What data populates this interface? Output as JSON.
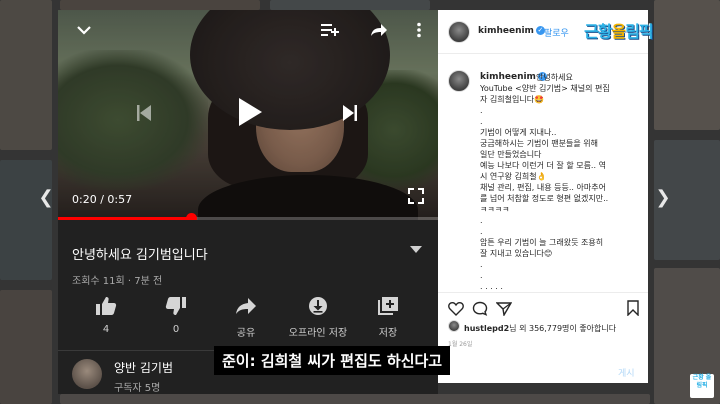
{
  "youtube": {
    "time_current": "0:20",
    "time_total": "0:57",
    "time_separator": " / ",
    "progress_fraction": 0.35,
    "video_title": "안녕하세요 김기범입니다",
    "video_meta": "조회수 11회 · 7분 전",
    "actions": [
      {
        "icon": "thumbs-up-icon",
        "label": "4"
      },
      {
        "icon": "thumbs-down-icon",
        "label": "0"
      },
      {
        "icon": "share-icon",
        "label": "공유"
      },
      {
        "icon": "download-icon",
        "label": "오프라인 저장"
      },
      {
        "icon": "save-to-playlist-icon",
        "label": "저장"
      }
    ],
    "channel_name": "양반 김기범",
    "channel_subscribers": "구독자 5명"
  },
  "instagram": {
    "username": "kimheenim",
    "follow_label": "팔로우",
    "caption_lines": [
      "안녕하세요",
      "YouTube <양반 김기범> 채널의 편집",
      "자 김희철입니다🤩",
      ".",
      ".",
      "기범이 어떻게 지내나..",
      "궁금해하시는 기범이 팬분들을 위해",
      "일단 만들었습니다",
      "예능 나보다 이런거 더 잘 할 모름.. 역",
      "시 연구왕 김희철👌",
      "채널 관리, 편집, 내용 등등.. 아마추어",
      "를 넘어 처참할 정도로 형편 없겠지만..",
      "ㅋㅋㅋㅋ",
      ".",
      ".",
      "암튼 우리 기범이 늘 그래왔듯 조용히",
      "잘 지내고 있습니다😊",
      ".",
      ".",
      ". . . . ."
    ],
    "likes_user": "hustlepd2",
    "likes_text": "님 외 356,779명이 좋아합니다",
    "date": "1월 26일",
    "post_label": "게시"
  },
  "overlay": {
    "logo_text_1": "근황",
    "logo_text_2": "올",
    "logo_text_3": "림픽",
    "subtitle": "준이: 김희철 씨가 편집도 하신다고",
    "watermark": "근황 올림픽"
  },
  "colors": {
    "youtube_red": "#ff0000",
    "instagram_blue": "#3897f0",
    "youtube_bg": "#212121"
  }
}
